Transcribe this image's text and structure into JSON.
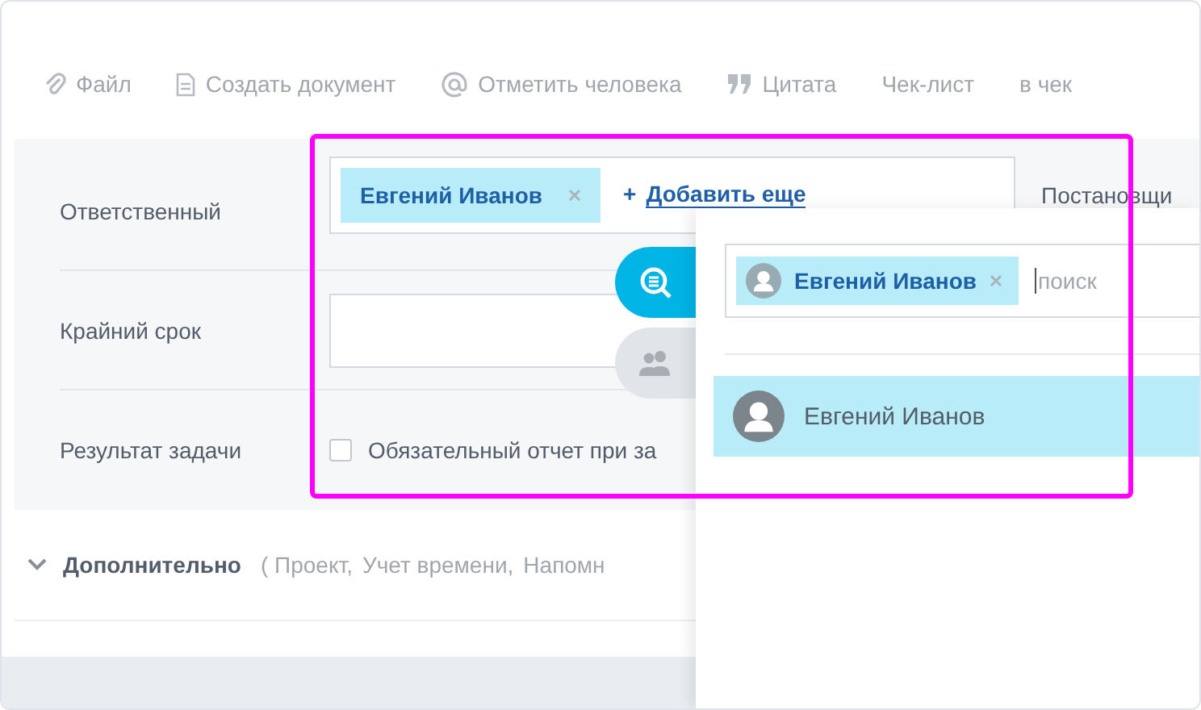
{
  "toolbar": [
    {
      "label": "Файл"
    },
    {
      "label": "Создать документ"
    },
    {
      "label": "Отметить человека"
    },
    {
      "label": "Цитата"
    },
    {
      "label": "Чек-лист"
    },
    {
      "label": "в чек"
    }
  ],
  "form": {
    "rows": [
      {
        "kind": "people",
        "label": "Ответственный",
        "tokens": [
          {
            "name": "Евгений Иванов"
          }
        ],
        "add_icon": "+",
        "add_label": "Добавить еще",
        "side_label": "Постановщи"
      },
      {
        "kind": "date",
        "label": "Крайний срок"
      },
      {
        "kind": "checkbox",
        "label": "Результат задачи",
        "option": "Обязательный отчет при за",
        "checked": false
      }
    ]
  },
  "more": {
    "title": "Дополнительно",
    "items": [
      "( Проект,",
      "Учет времени,",
      "Напомн"
    ]
  },
  "side_tabs": [
    {
      "kind": "search",
      "selected": true
    },
    {
      "kind": "people",
      "selected": false
    }
  ],
  "popup": {
    "token": "Евгений Иванов",
    "placeholder": "поиск",
    "results": [
      {
        "name": "Евгений Иванов",
        "selected": true
      }
    ]
  }
}
